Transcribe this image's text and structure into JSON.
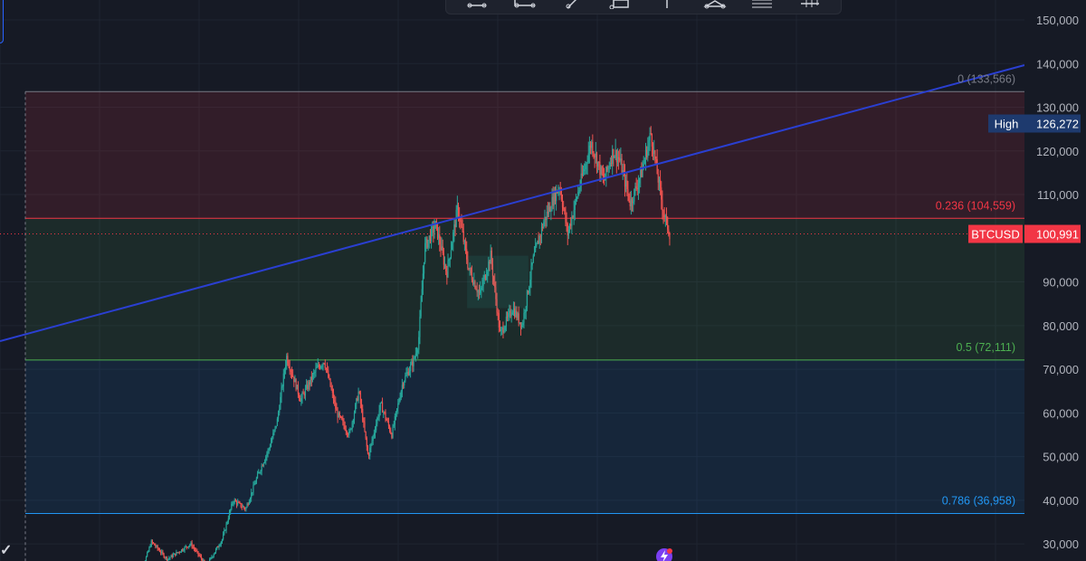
{
  "toolbar": {
    "tools": [
      "brush-tool-icon",
      "path-tool-icon",
      "ray-tool-icon",
      "rectangle-tool-icon",
      "vertical-line-icon",
      "polyline-tool-icon",
      "fib-tool-icon",
      "more-tools-icon"
    ]
  },
  "price_axis": {
    "labels": [
      "150,000",
      "140,000",
      "130,000",
      "120,000",
      "110,000",
      "90,000",
      "80,000",
      "70,000",
      "60,000",
      "50,000",
      "40,000",
      "30,000"
    ]
  },
  "fib_levels": [
    {
      "label": "0 (133,566)",
      "price": 133566,
      "color": "#787b86"
    },
    {
      "label": "0.236 (104,559)",
      "price": 104559,
      "color": "#f23645"
    },
    {
      "label": "0.5 (72,111)",
      "price": 72111,
      "color": "#4caf50"
    },
    {
      "label": "0.786 (36,958)",
      "price": 36958,
      "color": "#2196f3"
    }
  ],
  "high_tag": {
    "label": "High",
    "value": "126,272",
    "price": 126272
  },
  "symbol_tag": {
    "symbol": "BTCUSD",
    "value": "100,991",
    "price": 100991
  },
  "colors": {
    "background": "#161a25",
    "up_candle": "#26a69a",
    "down_candle": "#ef5350",
    "trendline": "#2a3fd1",
    "zone_top": "#f23645",
    "zone_mid": "#4caf50",
    "zone_low": "#2196f3"
  },
  "chart_data": {
    "type": "candlestick",
    "symbol": "BTCUSD",
    "y_range": [
      26000,
      156000
    ],
    "last_price": 100991,
    "high": 126272,
    "price_path": [
      [
        0,
        20000
      ],
      [
        10,
        30500
      ],
      [
        20,
        26500
      ],
      [
        35,
        30000
      ],
      [
        45,
        25000
      ],
      [
        55,
        31000
      ],
      [
        62,
        40000
      ],
      [
        70,
        38000
      ],
      [
        78,
        46000
      ],
      [
        85,
        52000
      ],
      [
        90,
        58000
      ],
      [
        96,
        73000
      ],
      [
        105,
        63000
      ],
      [
        115,
        70000
      ],
      [
        120,
        72000
      ],
      [
        128,
        60000
      ],
      [
        136,
        55000
      ],
      [
        142,
        65000
      ],
      [
        148,
        50000
      ],
      [
        156,
        62000
      ],
      [
        163,
        55000
      ],
      [
        170,
        67000
      ],
      [
        177,
        72000
      ],
      [
        180,
        76000
      ],
      [
        184,
        98000
      ],
      [
        191,
        103000
      ],
      [
        198,
        92000
      ],
      [
        205,
        107000
      ],
      [
        212,
        93000
      ],
      [
        219,
        87000
      ],
      [
        226,
        96000
      ],
      [
        232,
        78000
      ],
      [
        240,
        84000
      ],
      [
        246,
        80000
      ],
      [
        253,
        95000
      ],
      [
        260,
        104000
      ],
      [
        267,
        110000
      ],
      [
        270,
        112000
      ],
      [
        275,
        101000
      ],
      [
        282,
        111000
      ],
      [
        290,
        122000
      ],
      [
        298,
        113000
      ],
      [
        304,
        120000
      ],
      [
        308,
        118000
      ],
      [
        315,
        108000
      ],
      [
        322,
        115000
      ],
      [
        328,
        124000
      ],
      [
        336,
        106000
      ],
      [
        340,
        100991
      ]
    ]
  }
}
